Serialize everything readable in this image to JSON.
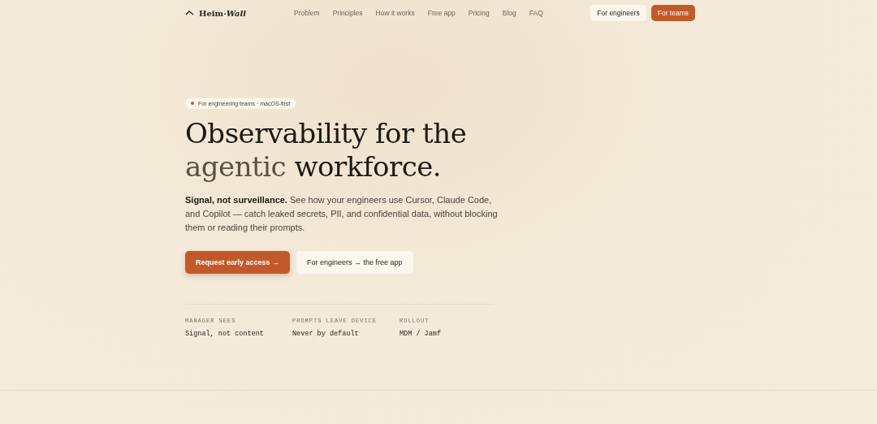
{
  "brand": {
    "name": "Heim·*Wall*"
  },
  "nav": [
    "Problem",
    "Principles",
    "How it works",
    "Free app",
    "Pricing",
    "Blog",
    "FAQ"
  ],
  "audience_toggle": [
    {
      "label": "For engineers",
      "selected": false
    },
    {
      "label": "For teams",
      "selected": true
    }
  ],
  "hero": {
    "badge": "For engineering teams · macOS-first",
    "headline": [
      {
        "text": "Observability for the",
        "muted": false
      },
      {
        "text": "agentic",
        "muted": true
      },
      {
        "text": "workforce.",
        "muted": false
      }
    ],
    "lede": "**Signal, not surveillance.** See how your engineers use Cursor, Claude Code, and Copilot — catch leaked secrets, PII, and confidential data, without blocking them or reading their prompts.",
    "primary_button": "Request early access →",
    "secondary_button": "For engineers → the free app"
  },
  "facts": [
    {
      "label": "MANAGER SEES",
      "value": "Signal, not content"
    },
    {
      "label": "PROMPTS LEAVE DEVICE",
      "value": "Never by default"
    },
    {
      "label": "ROLLOUT",
      "value": "MDM / Jamf"
    }
  ]
}
